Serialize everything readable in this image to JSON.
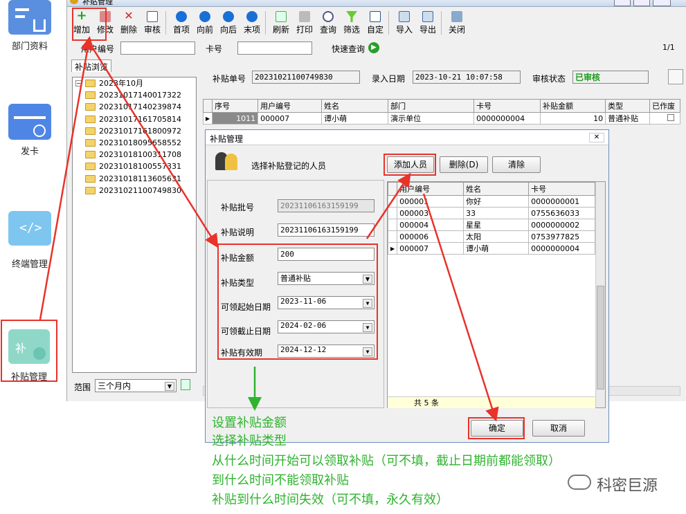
{
  "nav": {
    "items": [
      {
        "label": "部门资料"
      },
      {
        "label": "发卡"
      },
      {
        "label": "终端管理"
      },
      {
        "label": "补贴管理"
      }
    ]
  },
  "window": {
    "title": "补贴管理",
    "page_indicator": "1/1"
  },
  "toolbar": [
    {
      "label": "增加"
    },
    {
      "label": "修改"
    },
    {
      "label": "删除"
    },
    {
      "label": "审核"
    },
    {
      "label": "首项"
    },
    {
      "label": "向前"
    },
    {
      "label": "向后"
    },
    {
      "label": "末项"
    },
    {
      "label": "刷新"
    },
    {
      "label": "打印"
    },
    {
      "label": "查询"
    },
    {
      "label": "筛选"
    },
    {
      "label": "自定"
    },
    {
      "label": "导入"
    },
    {
      "label": "导出"
    },
    {
      "label": "关闭"
    }
  ],
  "search": {
    "user_id_label": "用户编号",
    "card_label": "卡号",
    "quick_query": "快速查询"
  },
  "tab": {
    "label": "补贴浏览"
  },
  "tree": {
    "root": "2023年10月",
    "items": [
      "20231017140017322",
      "20231017140239874",
      "20231017161705814",
      "20231017161800972",
      "20231018095658552",
      "20231018100311708",
      "20231018100557331",
      "20231018113605631",
      "20231021100749830"
    ]
  },
  "range": {
    "label": "范围",
    "value": "三个月内"
  },
  "header_fields": {
    "batch_label": "补贴单号",
    "batch_value": "20231021100749830",
    "date_label": "录入日期",
    "date_value": "2023-10-21 10:07:58",
    "status_label": "审核状态",
    "status_value": "已审核"
  },
  "main_grid": {
    "columns": [
      "序号",
      "用户编号",
      "姓名",
      "部门",
      "卡号",
      "补贴金额",
      "类型",
      "已作废"
    ],
    "rows": [
      [
        "1011",
        "000007",
        "谭小萌",
        "演示单位",
        "0000000004",
        "10",
        "普通补贴",
        ""
      ]
    ]
  },
  "dialog": {
    "title": "补贴管理",
    "instruction": "选择补贴登记的人员",
    "add_button": "添加人员",
    "delete_button": "删除(D)",
    "clear_button": "清除",
    "ok_button": "确定",
    "cancel_button": "取消",
    "fields": {
      "batch_no_label": "补贴批号",
      "batch_no_value": "20231106163159199",
      "desc_label": "补贴说明",
      "desc_value": "20231106163159199",
      "amount_label": "补贴金额",
      "amount_value": "200",
      "type_label": "补贴类型",
      "type_value": "普通补贴",
      "start_label": "可领起始日期",
      "start_value": "2023-11-06",
      "end_label": "可领截止日期",
      "end_value": "2024-02-06",
      "expire_label": "补贴有效期",
      "expire_value": "2024-12-12"
    },
    "grid": {
      "columns": [
        "用户编号",
        "姓名",
        "卡号"
      ],
      "rows": [
        [
          "000001",
          "你好",
          "0000000001"
        ],
        [
          "000003",
          "33",
          "0755636033"
        ],
        [
          "000004",
          "星星",
          "0000000002"
        ],
        [
          "000006",
          "太阳",
          "0753977825"
        ],
        [
          "000007",
          "谭小萌",
          "0000000004"
        ]
      ],
      "footer": "共 5 条"
    }
  },
  "annotations": [
    "设置补贴金额",
    "选择补贴类型",
    "从什么时间开始可以领取补贴（可不填，截止日期前都能领取）",
    "到什么时间不能领取补贴",
    "补贴到什么时间失效（可不填，永久有效）"
  ],
  "watermark": "科密巨源",
  "colors": {
    "accent_red": "#e8322a",
    "annotation_green": "#2fb32f",
    "status_green": "#1a9c1a"
  }
}
